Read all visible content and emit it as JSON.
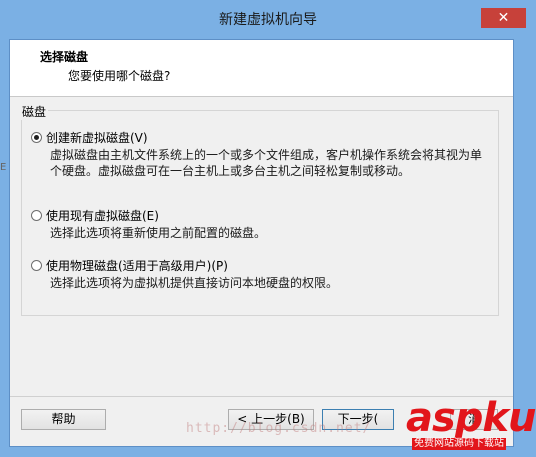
{
  "window": {
    "title": "新建虚拟机向导",
    "close_glyph": "✕"
  },
  "header": {
    "title": "选择磁盘",
    "subtitle": "您要使用哪个磁盘?"
  },
  "group": {
    "label": "磁盘"
  },
  "options": [
    {
      "label": "创建新虚拟磁盘(V)",
      "checked": true,
      "desc_line1": "虚拟磁盘由主机文件系统上的一个或多个文件组成，客户机操作系统会将其视为单",
      "desc_line2": "个硬盘。虚拟磁盘可在一台主机上或多台主机之间轻松复制或移动。"
    },
    {
      "label": "使用现有虚拟磁盘(E)",
      "checked": false,
      "desc_line1": "选择此选项将重新使用之前配置的磁盘。"
    },
    {
      "label": "使用物理磁盘(适用于高级用户)(P)",
      "checked": false,
      "desc_line1": "选择此选项将为虚拟机提供直接访问本地硬盘的权限。"
    }
  ],
  "buttons": {
    "help": "帮助",
    "back": "< 上一步(B)",
    "next": "下一步(",
    "cancel": "消"
  },
  "watermark": {
    "text": "http://blog.csdn.net/"
  },
  "logo": {
    "main": "aspku",
    "sub": "免费网站源码下载站"
  },
  "left_mark": "E"
}
